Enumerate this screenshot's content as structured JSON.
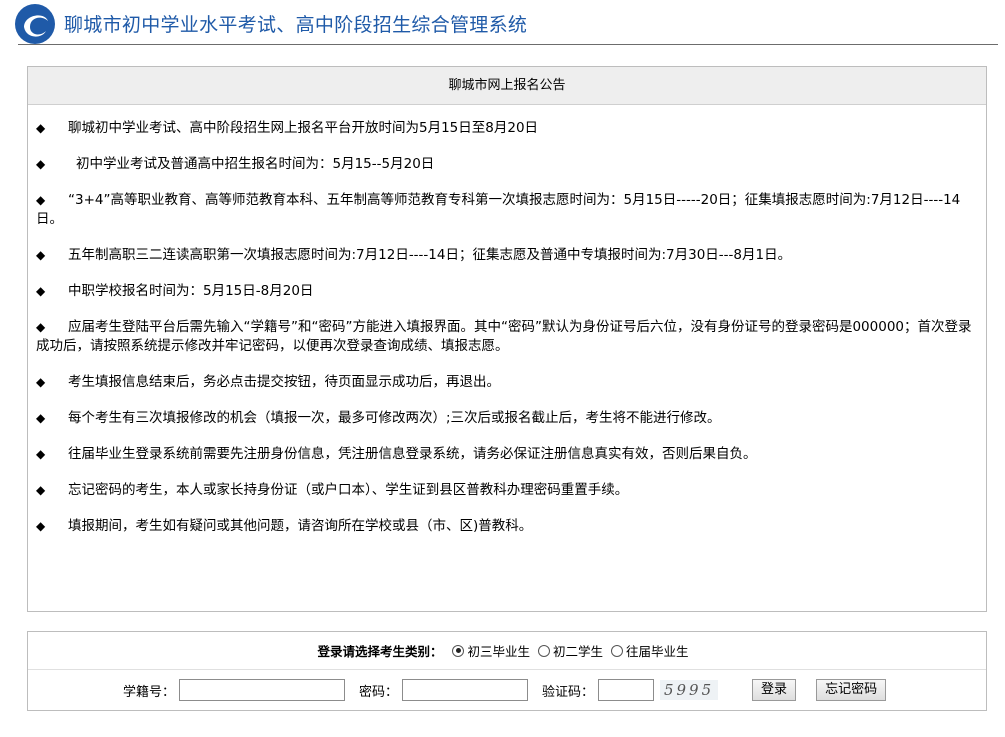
{
  "header": {
    "title": "聊城市初中学业水平考试、高中阶段招生综合管理系统",
    "logo_icon": "swirl-logo-icon",
    "brand_color": "#1f5aa8"
  },
  "notice": {
    "title": "聊城市网上报名公告",
    "bullet": "◆",
    "items": [
      "聊城初中学业考试、高中阶段招生网上报名平台开放时间为5月15日至8月20日",
      "初中学业考试及普通高中招生报名时间为：5月15--5月20日",
      "“3+4”高等职业教育、高等师范教育本科、五年制高等师范教育专科第一次填报志愿时间为：5月15日-----20日；征集填报志愿时间为:7月12日----14日。",
      "五年制高职三二连读高职第一次填报志愿时间为:7月12日----14日；征集志愿及普通中专填报时间为:7月30日---8月1日。",
      "中职学校报名时间为：5月15日-8月20日",
      "应届考生登陆平台后需先输入“学籍号”和“密码”方能进入填报界面。其中“密码”默认为身份证号后六位，没有身份证号的登录密码是000000；首次登录成功后，请按照系统提示修改并牢记密码，以便再次登录查询成绩、填报志愿。",
      "考生填报信息结束后，务必点击提交按钮，待页面显示成功后，再退出。",
      "每个考生有三次填报修改的机会（填报一次，最多可修改两次）;三次后或报名截止后，考生将不能进行修改。",
      "往届毕业生登录系统前需要先注册身份信息，凭注册信息登录系统，请务必保证注册信息真实有效，否则后果自负。",
      "忘记密码的考生，本人或家长持身份证（或户口本）、学生证到县区普教科办理密码重置手续。",
      "填报期间，考生如有疑问或其他问题，请咨询所在学校或县（市、区)普教科。"
    ]
  },
  "login": {
    "category_label": "登录请选择考生类别：",
    "options": [
      "初三毕业生",
      "初二学生",
      "往届毕业生"
    ],
    "selected": "初三毕业生",
    "student_id_label": "学籍号：",
    "student_id_value": "",
    "password_label": "密码：",
    "password_value": "",
    "captcha_label": "验证码：",
    "captcha_value": "",
    "captcha_image_text": "5995",
    "login_button": "登录",
    "forgot_button": "忘记密码"
  }
}
